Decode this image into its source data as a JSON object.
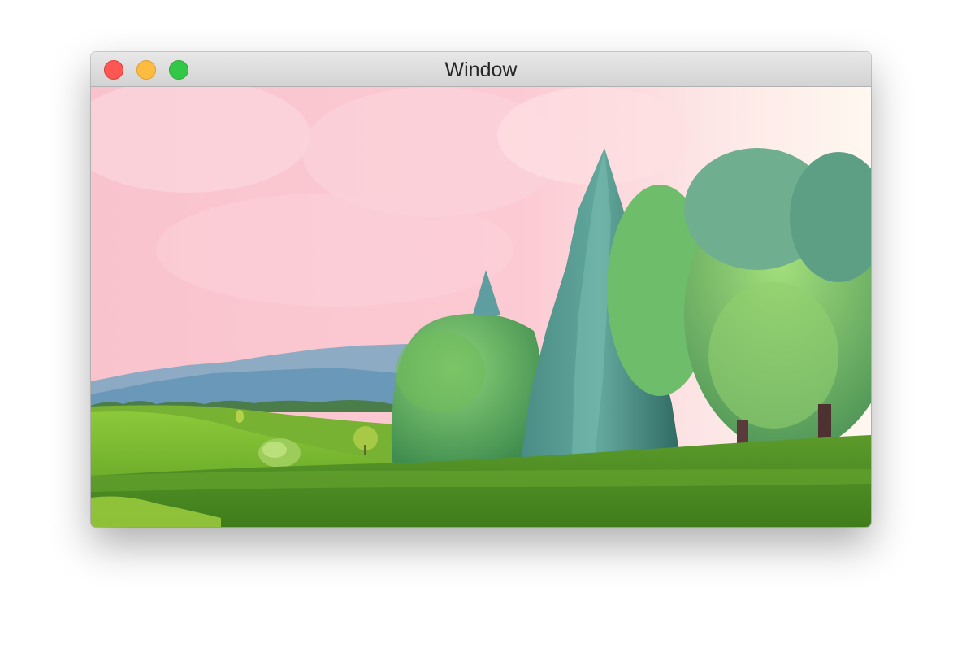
{
  "window": {
    "title": "Window",
    "controls": {
      "close": "close-button",
      "minimize": "minimize-button",
      "zoom": "zoom-button"
    },
    "colors": {
      "close": "#fc5753",
      "minimize": "#fdbc40",
      "zoom": "#33c748"
    }
  },
  "content": {
    "description_icon": "landscape-video-frame"
  }
}
